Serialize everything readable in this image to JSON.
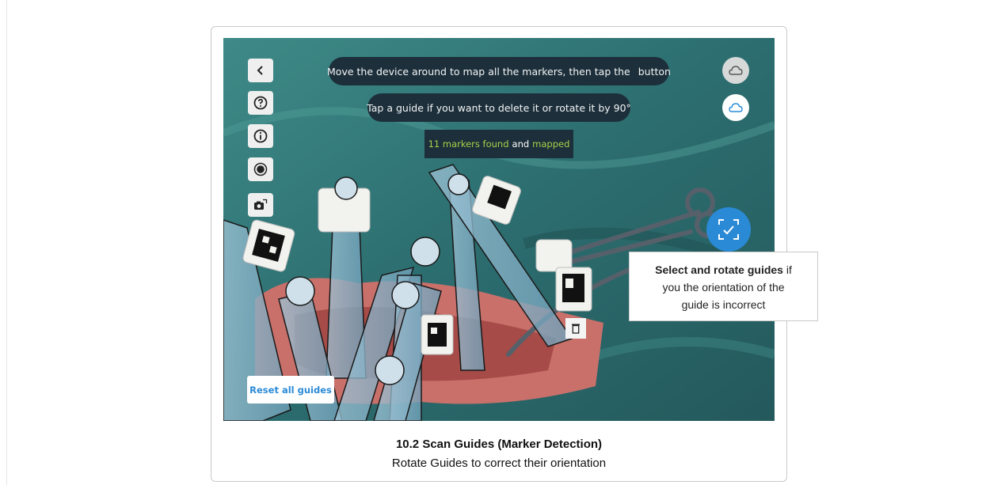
{
  "instructions": {
    "map_markers_before": "Move the device around to map all the markers, then tap the",
    "map_markers_after": "button",
    "tap_guide": "Tap a guide if you want to delete it or rotate it by 90°"
  },
  "status": {
    "markers_found": "11 markers found",
    "conjunction": "and",
    "mapped": "mapped"
  },
  "reset_button_label": "Reset all guides",
  "callout": {
    "bold": "Select and rotate guides",
    "line1_rest": "if",
    "line2": "you the orientation of the",
    "line3": "guide is incorrect"
  },
  "caption": {
    "title": "10.2 Scan Guides (Marker Detection)",
    "subtitle": "Rotate Guides to correct their orientation"
  },
  "icons": {
    "left_toolbar": [
      "back-icon",
      "help-icon",
      "info-icon",
      "record-icon",
      "camera-switch-icon"
    ],
    "right_top": [
      "cloud-icon",
      "cloud-selected-icon"
    ],
    "confirm": "check-scan-icon",
    "delete": "trash-icon"
  },
  "colors": {
    "accent": "#2a8ad6",
    "pill_bg": "#1d2f3a",
    "status_green": "#a8d04a",
    "drape": "#2f6f70"
  }
}
